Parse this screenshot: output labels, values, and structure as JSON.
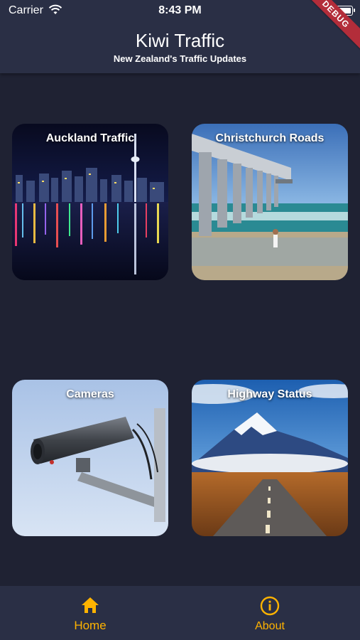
{
  "status_bar": {
    "carrier": "Carrier",
    "time": "8:43 PM",
    "icons": [
      "wifi-icon",
      "battery-icon"
    ]
  },
  "debug_banner": "DEBUG",
  "header": {
    "title": "Kiwi Traffic",
    "subtitle": "New Zealand's Traffic Updates"
  },
  "tiles": [
    {
      "label": "Auckland Traffic",
      "image": "auckland-night-skyline"
    },
    {
      "label": "Christchurch Roads",
      "image": "christchurch-pier"
    },
    {
      "label": "Cameras",
      "image": "security-camera"
    },
    {
      "label": "Highway Status",
      "image": "mountain-highway"
    }
  ],
  "bottom_nav": [
    {
      "label": "Home",
      "icon": "home-icon",
      "active": true
    },
    {
      "label": "About",
      "icon": "info-icon",
      "active": false
    }
  ],
  "colors": {
    "background": "#1f2233",
    "appbar": "#2a2f45",
    "accent": "#ffb300",
    "debug": "#b32d3a"
  }
}
